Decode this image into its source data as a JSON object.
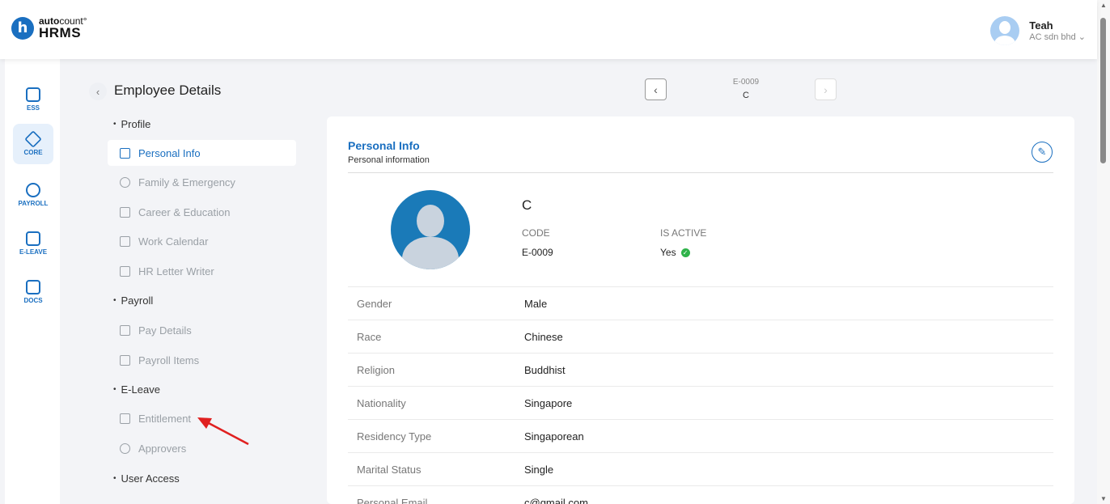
{
  "brand": {
    "logo_letter": "h",
    "top_bold": "auto",
    "top_light": "count",
    "mark": "°",
    "bottom": "HRMS"
  },
  "user": {
    "name": "Teah",
    "company": "AC sdn bhd",
    "caret": "⌄"
  },
  "rail": [
    {
      "label": "ESS"
    },
    {
      "label": "CORE"
    },
    {
      "label": "PAYROLL"
    },
    {
      "label": "E-LEAVE"
    },
    {
      "label": "DOCS"
    }
  ],
  "page": {
    "title": "Employee Details"
  },
  "record": {
    "code": "E-0009",
    "name": "C"
  },
  "nav": {
    "profile": "Profile",
    "personal_info": "Personal Info",
    "family": "Family & Emergency",
    "career": "Career & Education",
    "calendar": "Work Calendar",
    "letter": "HR Letter Writer",
    "payroll": "Payroll",
    "pay_details": "Pay Details",
    "payroll_items": "Payroll Items",
    "eleave": "E-Leave",
    "entitlement": "Entitlement",
    "approvers": "Approvers",
    "user_access": "User Access"
  },
  "card": {
    "title": "Personal Info",
    "subtitle": "Personal information",
    "name": "C",
    "code_label": "CODE",
    "code_value": "E-0009",
    "active_label": "IS ACTIVE",
    "active_value": "Yes"
  },
  "details": [
    {
      "label": "Gender",
      "value": "Male"
    },
    {
      "label": "Race",
      "value": "Chinese"
    },
    {
      "label": "Religion",
      "value": "Buddhist"
    },
    {
      "label": "Nationality",
      "value": "Singapore"
    },
    {
      "label": "Residency Type",
      "value": "Singaporean"
    },
    {
      "label": "Marital Status",
      "value": "Single"
    },
    {
      "label": "Personal Email",
      "value": "c@gmail.com"
    }
  ],
  "colors": {
    "accent": "#1a6fc0",
    "active_check": "#2fb34a",
    "annotation_arrow": "#e02020"
  },
  "icons": {
    "back": "‹",
    "prev": "‹",
    "next": "›",
    "edit": "✎",
    "check": "✓"
  }
}
